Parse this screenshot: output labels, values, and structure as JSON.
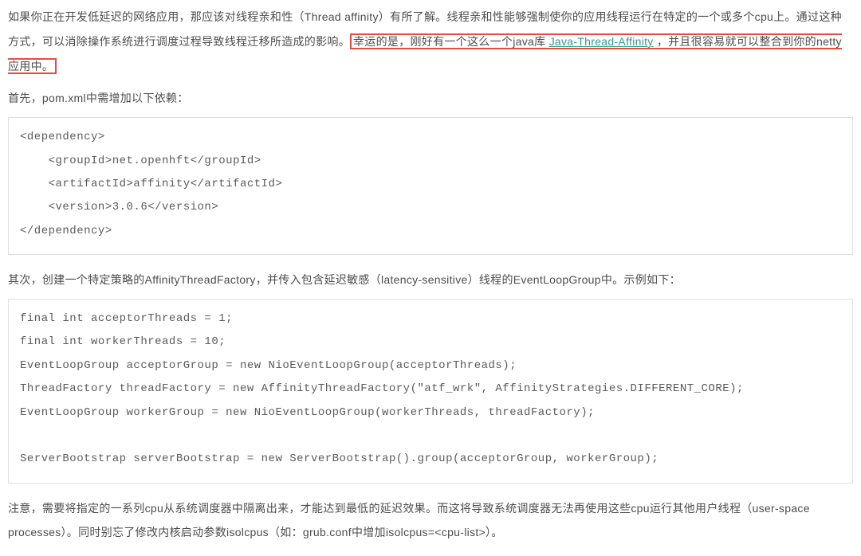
{
  "para1_part1": "如果你正在开发低延迟的网络应用，那应该对线程亲和性（Thread affinity）有所了解。线程亲和性能够强制使你的应用线程运行在特定的一个或多个cpu上。通过这种方式，可以消除操作系统进行调度过程导致线程迁移所造成的影响。",
  "highlight_before_link": "幸运的是，刚好有一个这么一个java库 ",
  "link_text": "Java-Thread-Affinity",
  "highlight_after_link": " ，并且很容易就可以整合到你的netty应用中。",
  "para2": "首先，pom.xml中需增加以下依赖：",
  "code1": "<dependency>\n    <groupId>net.openhft</groupId>\n    <artifactId>affinity</artifactId>\n    <version>3.0.6</version>\n</dependency>",
  "para3": "其次，创建一个特定策略的AffinityThreadFactory，并传入包含延迟敏感（latency-sensitive）线程的EventLoopGroup中。示例如下：",
  "code2": "final int acceptorThreads = 1;\nfinal int workerThreads = 10;\nEventLoopGroup acceptorGroup = new NioEventLoopGroup(acceptorThreads);\nThreadFactory threadFactory = new AffinityThreadFactory(\"atf_wrk\", AffinityStrategies.DIFFERENT_CORE);\nEventLoopGroup workerGroup = new NioEventLoopGroup(workerThreads, threadFactory);\n\nServerBootstrap serverBootstrap = new ServerBootstrap().group(acceptorGroup, workerGroup);",
  "para4": "注意，需要将指定的一系列cpu从系统调度器中隔离出来，才能达到最低的延迟效果。而这将导致系统调度器无法再使用这些cpu运行其他用户线程（user-space processes）。同时别忘了修改内核启动参数isolcpus（如：grub.conf中增加isolcpus=<cpu-list>）。"
}
